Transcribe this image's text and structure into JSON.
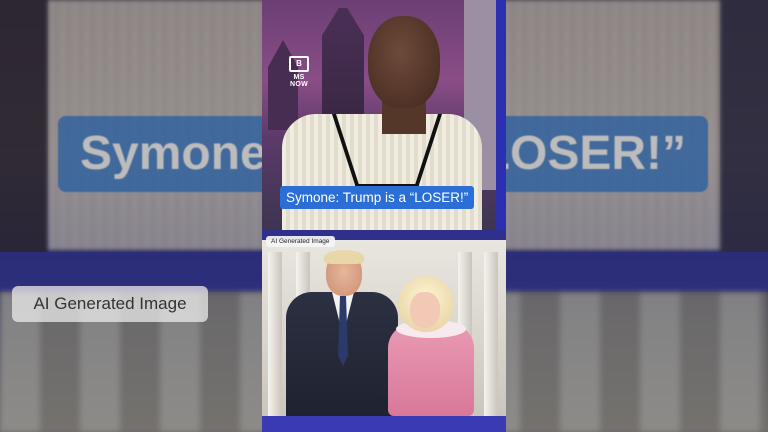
{
  "video": {
    "channel_logo_text": "MS NOW",
    "caption": "Symone: Trump is a “LOSER!”",
    "ai_label": "AI Generated Image"
  },
  "background": {
    "caption_left": "Symone:",
    "caption_right": "“LOSER!”",
    "ai_label": "AI Generated Image"
  },
  "colors": {
    "caption_bg": "#2b6fd6",
    "divider": "#2f2f8e",
    "studio_purple": "#8a4d86"
  }
}
